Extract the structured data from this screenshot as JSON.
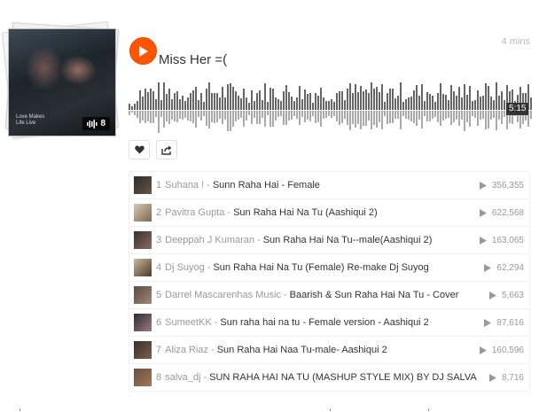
{
  "set": {
    "title": "Miss Her =(",
    "time_ago": "4 mins",
    "duration": "5:15",
    "track_count": "8",
    "artwork_caption": "Love Makes\nLife Live",
    "colors": {
      "accent": "#ff5500",
      "waveform": "#666666"
    }
  },
  "actions": {
    "like_icon": "heart-icon",
    "share_icon": "share-icon"
  },
  "tracks": [
    {
      "num": "1",
      "artist": "Suhana !",
      "title": "Sunn Raha Hai - Female",
      "plays": "356,355"
    },
    {
      "num": "2",
      "artist": "Pavitra Gupta",
      "title": "Sun Raha Hai Na Tu (Aashiqui 2)",
      "plays": "622,568"
    },
    {
      "num": "3",
      "artist": "Deeppah J Kumaran",
      "title": "Sun Raha Hai Na Tu--male(Aashiqui 2)",
      "plays": "163,065"
    },
    {
      "num": "4",
      "artist": "Dj Suyog",
      "title": "Sun Raha Hai Na Tu (Female) Re-make Dj Suyog",
      "plays": "62,294"
    },
    {
      "num": "5",
      "artist": "Darrel Mascarenhas Music",
      "title": "Baarish & Sun Raha Hai Na Tu - Cover",
      "plays": "5,663"
    },
    {
      "num": "6",
      "artist": "SumeetKK",
      "title": "Sun raha hai na tu - Female version - Aashiqui 2",
      "plays": "87,616"
    },
    {
      "num": "7",
      "artist": "Aliza Riaz",
      "title": "Sun Raha Hai Naa Tu-male- Aashiqui 2",
      "plays": "160,596"
    },
    {
      "num": "8",
      "artist": "salva_dj",
      "title": "SUN RAHA HAI NA TU (MASHUP STYLE MIX) BY DJ SALVA",
      "plays": "8,716"
    }
  ]
}
